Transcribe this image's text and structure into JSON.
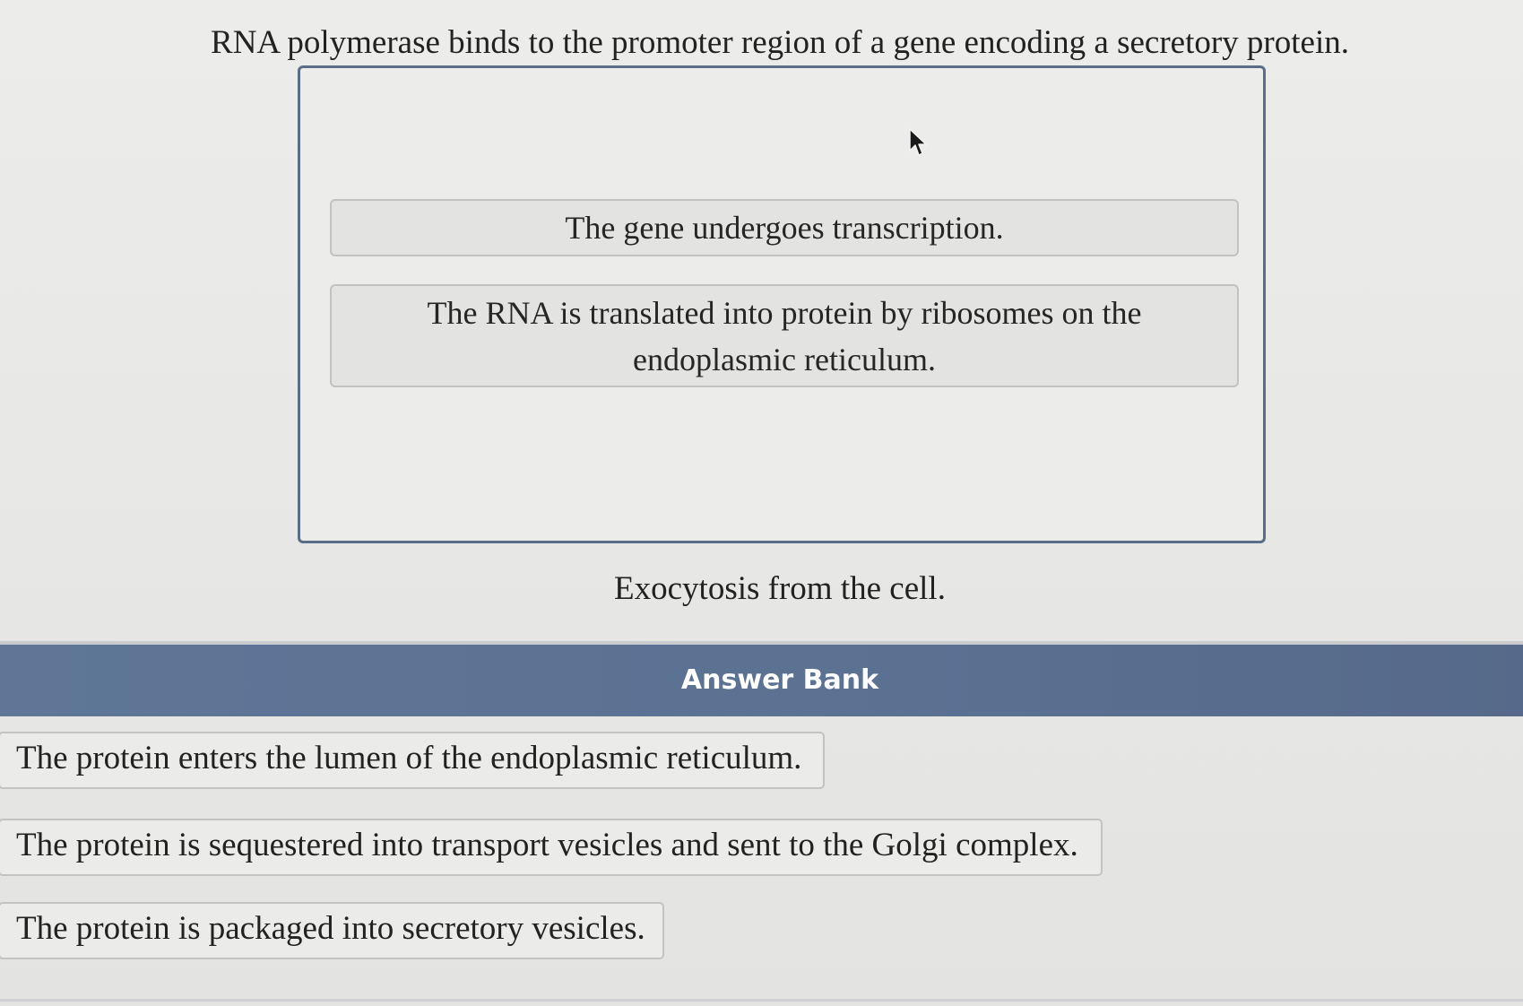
{
  "question": {
    "title": "RNA polymerase binds to the promoter region of a gene encoding a secretory protein."
  },
  "drop_zone": {
    "placed_items": [
      {
        "text": "The gene undergoes transcription."
      },
      {
        "line1": "The RNA is translated into protein by ribosomes on the",
        "line2": "endoplasmic reticulum."
      }
    ]
  },
  "end_step": "Exocytosis from the cell.",
  "answer_bank": {
    "title": "Answer Bank",
    "items": [
      {
        "text": "The protein enters the lumen of the endoplasmic reticulum."
      },
      {
        "text": "The protein is sequestered into transport vesicles and sent to the Golgi complex."
      },
      {
        "text": "The protein is packaged into secretory vesicles."
      }
    ]
  },
  "icons": {
    "cursor": "mouse-pointer-icon"
  },
  "colors": {
    "bank_header": "#5b7192",
    "drop_zone_border": "#5b6d86",
    "background": "#e9e9e7"
  }
}
